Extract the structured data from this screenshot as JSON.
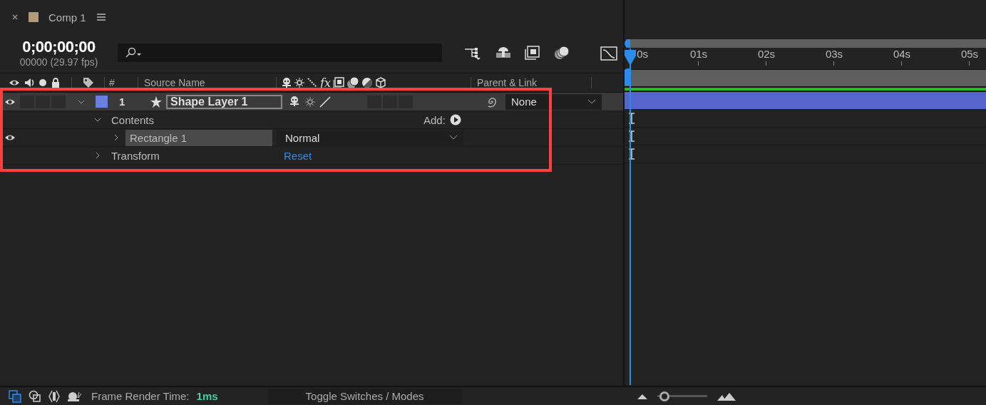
{
  "tab": {
    "title": "Comp 1",
    "color": "#b09a7a"
  },
  "timecode": "0;00;00;00",
  "frame_info": "00000 (29.97 fps)",
  "columns": {
    "effects": "fx",
    "number": "#",
    "source_name": "Source Name",
    "parent": "Parent & Link"
  },
  "layer": {
    "number": "1",
    "name": "Shape Layer 1",
    "color": "#6b7fe0",
    "visible": true,
    "expanded": true,
    "parent": "None"
  },
  "properties": [
    {
      "name": "Contents",
      "expanded": true,
      "action": "Add:",
      "children": [
        {
          "name": "Rectangle 1",
          "expanded": false,
          "visible": true,
          "selected": true,
          "mode": "Normal"
        }
      ]
    },
    {
      "name": "Transform",
      "expanded": false,
      "link": "Reset"
    }
  ],
  "timeline": {
    "ticks": [
      "0s",
      "01s",
      "02s",
      "03s",
      "04s",
      "05s"
    ]
  },
  "status": {
    "label": "Frame Render Time:",
    "value": "1ms",
    "toggle": "Toggle Switches / Modes"
  },
  "zoom": {
    "level": 0.05
  }
}
